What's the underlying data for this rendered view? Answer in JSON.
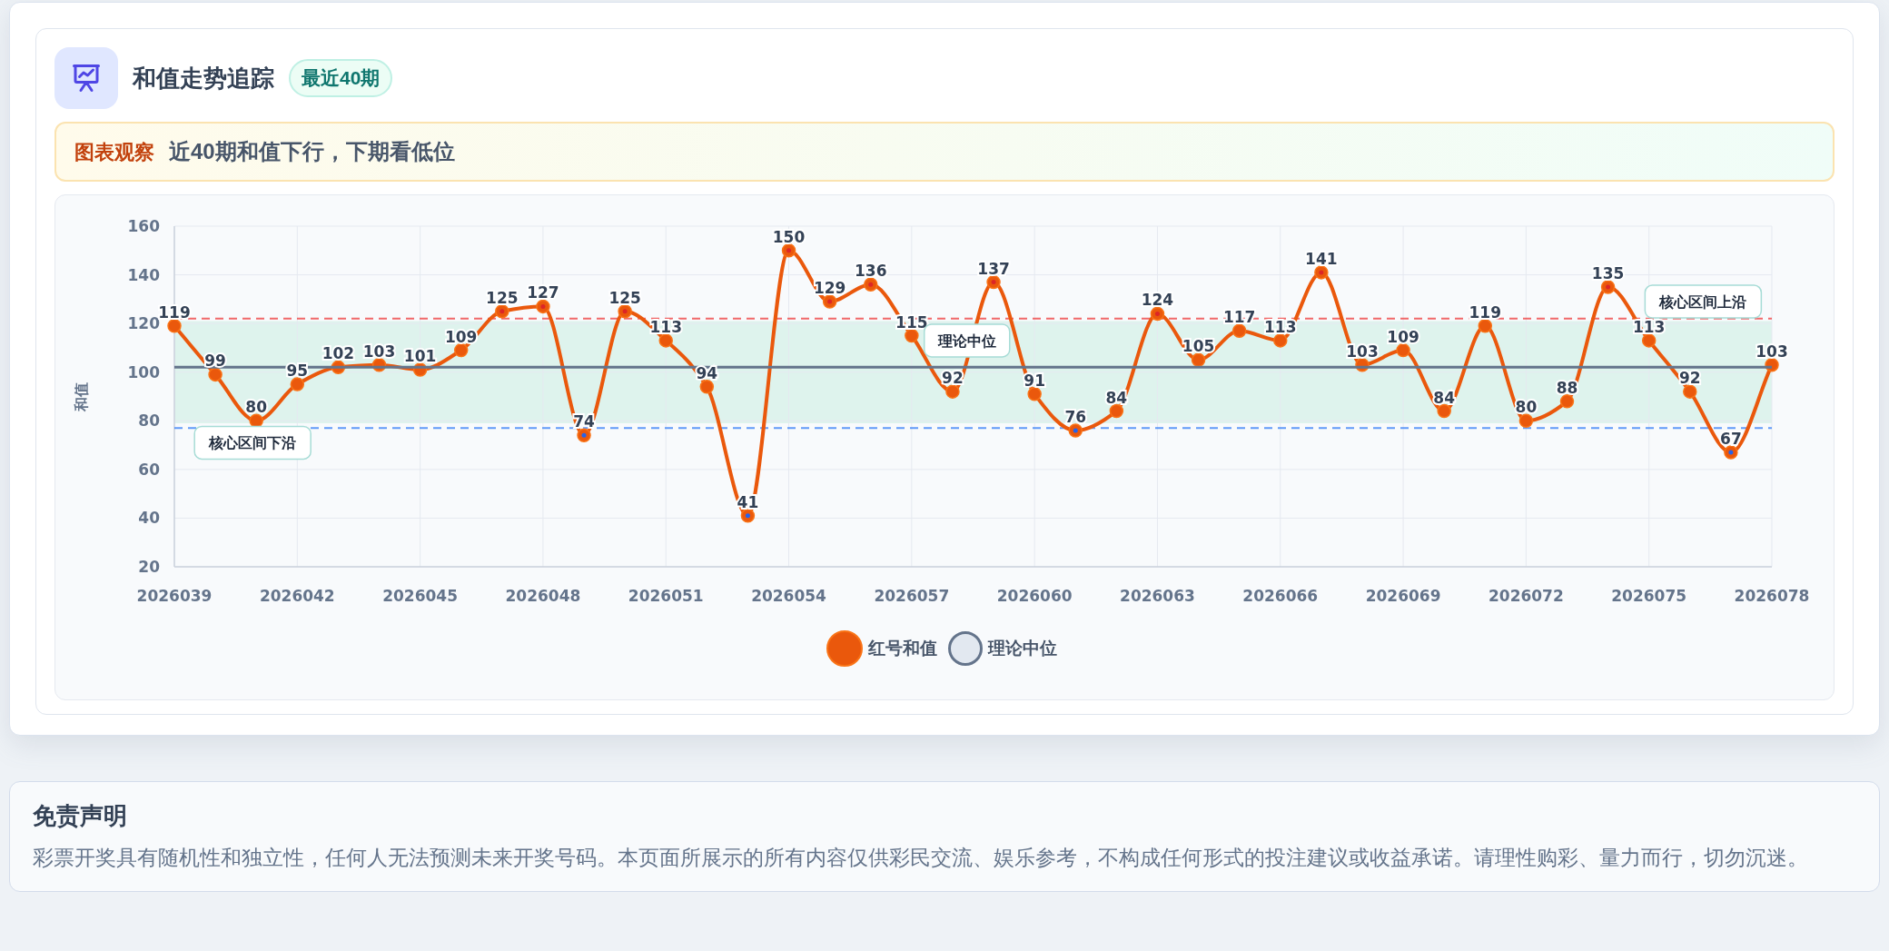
{
  "header": {
    "title": "和值走势追踪",
    "badge": "最近40期"
  },
  "notice": {
    "label": "图表观察",
    "text": "近40期和值下行，下期看低位"
  },
  "chart": {
    "chart_data": {
      "type": "line",
      "ylabel": "和值",
      "x": [
        2026039,
        2026040,
        2026041,
        2026042,
        2026043,
        2026044,
        2026045,
        2026046,
        2026047,
        2026048,
        2026049,
        2026050,
        2026051,
        2026052,
        2026053,
        2026054,
        2026055,
        2026056,
        2026057,
        2026058,
        2026059,
        2026060,
        2026061,
        2026062,
        2026063,
        2026064,
        2026065,
        2026066,
        2026067,
        2026068,
        2026069,
        2026070,
        2026071,
        2026072,
        2026073,
        2026074,
        2026075,
        2026076,
        2026077,
        2026078
      ],
      "xlim": [
        2026039,
        2026078
      ],
      "xticks": [
        2026039,
        2026042,
        2026045,
        2026048,
        2026051,
        2026054,
        2026057,
        2026060,
        2026063,
        2026066,
        2026069,
        2026072,
        2026075,
        2026078
      ],
      "ylim": [
        20,
        160
      ],
      "yticks": [
        20,
        40,
        60,
        80,
        100,
        120,
        140,
        160
      ],
      "grid": true,
      "legend": true,
      "series": [
        {
          "name": "红号和值",
          "color": "#ea580c",
          "marker": "circle",
          "values": [
            119,
            99,
            80,
            95,
            102,
            103,
            101,
            109,
            125,
            127,
            74,
            125,
            113,
            94,
            41,
            150,
            129,
            136,
            115,
            92,
            137,
            91,
            76,
            84,
            124,
            105,
            117,
            113,
            141,
            103,
            109,
            84,
            119,
            80,
            88,
            135,
            113,
            92,
            67,
            103
          ]
        },
        {
          "name": "理论中位",
          "color": "#64748b",
          "values": [
            102,
            102,
            102,
            102,
            102,
            102,
            102,
            102,
            102,
            102,
            102,
            102,
            102,
            102,
            102,
            102,
            102,
            102,
            102,
            102,
            102,
            102,
            102,
            102,
            102,
            102,
            102,
            102,
            102,
            102,
            102,
            102,
            102,
            102,
            102,
            102,
            102,
            102,
            102,
            102
          ]
        }
      ],
      "value_labels": [
        [
          "119",
          "99",
          "80",
          "95",
          "102",
          "103",
          "101",
          "109",
          "125",
          "127",
          "74",
          "125",
          "113",
          "94",
          "41",
          "150",
          "129",
          "136",
          "115",
          "92",
          "137",
          "91",
          "76",
          "84",
          "124",
          "105",
          "117",
          "113",
          "141",
          "103",
          "109",
          "84",
          "119",
          "80",
          "88",
          "135",
          "113",
          "92",
          "67",
          "103"
        ],
        null
      ],
      "ref_lines": [
        {
          "axis": "y",
          "value": 122,
          "color": "#ef4444",
          "label": "核心区间上沿"
        },
        {
          "axis": "y",
          "value": 77,
          "color": "#3b82f6",
          "label": "核心区间下沿"
        }
      ],
      "bands": [
        {
          "axis": "y",
          "from": 79,
          "to": 121,
          "color": "#d6f0e8"
        }
      ],
      "annotations": [
        {
          "text": "理论中位",
          "x": 2026058.35,
          "y": 113
        }
      ]
    }
  },
  "disclaimer": {
    "title": "免责声明",
    "text": "彩票开奖具有随机性和独立性，任何人无法预测未来开奖号码。本页面所展示的所有内容仅供彩民交流、娱乐参考，不构成任何形式的投注建议或收益承诺。请理性购彩、量力而行，切勿沉迷。"
  }
}
